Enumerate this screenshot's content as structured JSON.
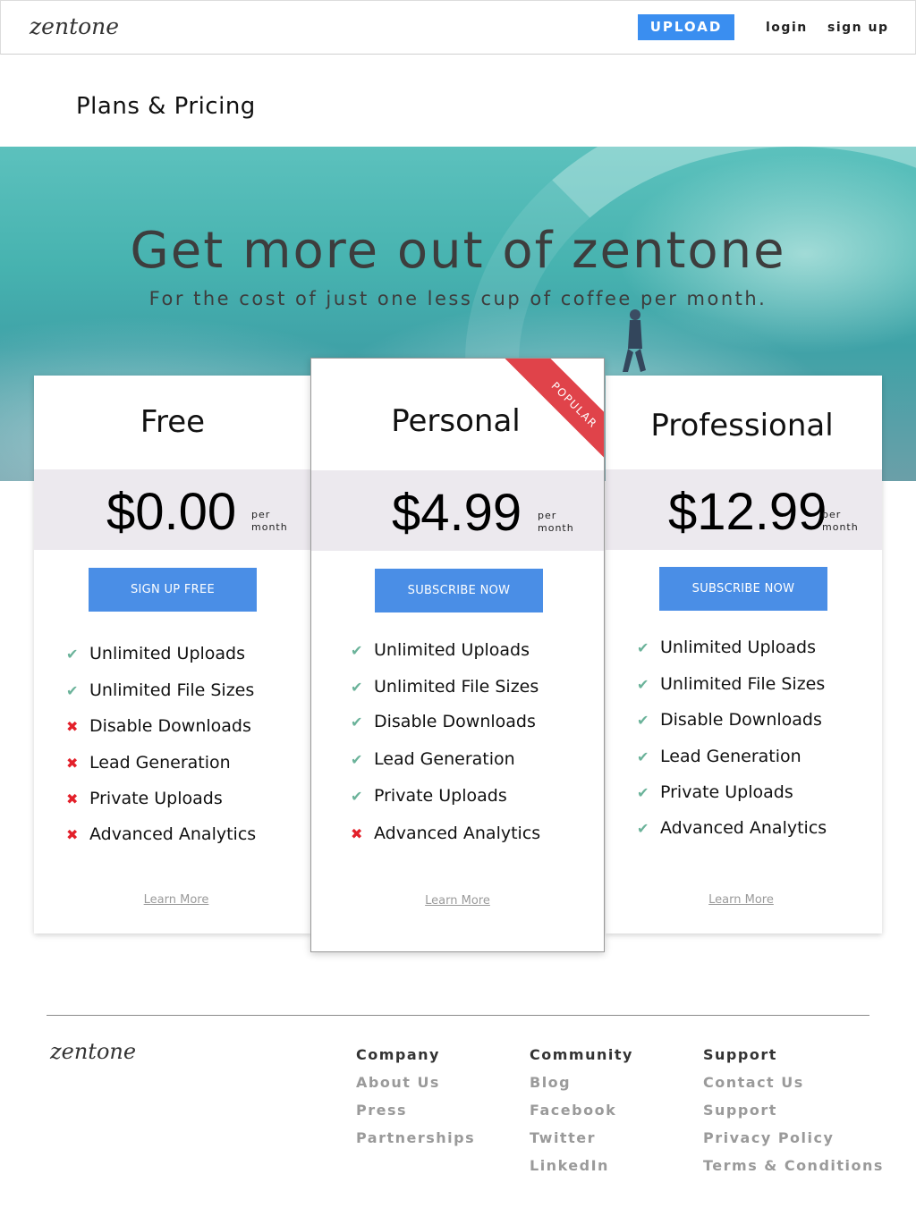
{
  "header": {
    "logo": "zentone",
    "upload_label": "UPLOAD",
    "login_label": "login",
    "signup_label": "sign up"
  },
  "page_title": "Plans & Pricing",
  "hero": {
    "title": "Get more out of zentone",
    "subtitle": "For the cost of just one less cup of coffee per month."
  },
  "plans": [
    {
      "name": "Free",
      "price": "$0.00",
      "per": "per",
      "period": "month",
      "cta": "SIGN UP FREE",
      "features": [
        {
          "label": "Unlimited Uploads",
          "included": true
        },
        {
          "label": "Unlimited File Sizes",
          "included": true
        },
        {
          "label": "Disable Downloads",
          "included": false
        },
        {
          "label": "Lead Generation",
          "included": false
        },
        {
          "label": "Private Uploads",
          "included": false
        },
        {
          "label": "Advanced Analytics",
          "included": false
        }
      ],
      "learn_more": "Learn More"
    },
    {
      "name": "Personal",
      "badge": "POPULAR",
      "price": "$4.99",
      "per": "per",
      "period": "month",
      "cta": "SUBSCRIBE NOW",
      "features": [
        {
          "label": "Unlimited Uploads",
          "included": true
        },
        {
          "label": "Unlimited File Sizes",
          "included": true
        },
        {
          "label": "Disable Downloads",
          "included": true
        },
        {
          "label": "Lead Generation",
          "included": true
        },
        {
          "label": "Private Uploads",
          "included": true
        },
        {
          "label": "Advanced Analytics",
          "included": false
        }
      ],
      "learn_more": "Learn More"
    },
    {
      "name": "Professional",
      "price": "$12.99",
      "per": "per",
      "period": "month",
      "cta": "SUBSCRIBE NOW",
      "features": [
        {
          "label": "Unlimited Uploads",
          "included": true
        },
        {
          "label": "Unlimited File Sizes",
          "included": true
        },
        {
          "label": "Disable Downloads",
          "included": true
        },
        {
          "label": "Lead Generation",
          "included": true
        },
        {
          "label": "Private Uploads",
          "included": true
        },
        {
          "label": "Advanced Analytics",
          "included": true
        }
      ],
      "learn_more": "Learn More"
    }
  ],
  "icons": {
    "included": "check-icon",
    "excluded": "cross-icon"
  },
  "colors": {
    "primary": "#3a8ef0",
    "button": "#4a8ee6",
    "ribbon": "#e0434a",
    "check": "#6bb39a",
    "cross": "#e3202a",
    "price_band": "#ece9ee"
  },
  "footer": {
    "logo": "zentone",
    "columns": [
      {
        "heading": "Company",
        "links": [
          "About Us",
          "Press",
          "Partnerships"
        ]
      },
      {
        "heading": "Community",
        "links": [
          "Blog",
          "Facebook",
          "Twitter",
          "LinkedIn"
        ]
      },
      {
        "heading": "Support",
        "links": [
          "Contact Us",
          "Support",
          "Privacy Policy",
          "Terms & Conditions"
        ]
      }
    ]
  }
}
